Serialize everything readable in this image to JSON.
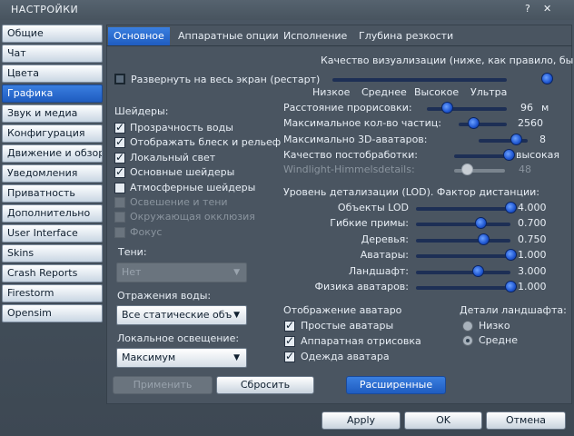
{
  "window": {
    "title": "НАСТРОЙКИ",
    "help": "?",
    "close": "✕"
  },
  "sidebar": [
    "Общие",
    "Чат",
    "Цвета",
    "Графика",
    "Звук и медиа",
    "Конфигурация",
    "Движение и обзор",
    "Уведомления",
    "Приватность",
    "Дополнительно",
    "User Interface",
    "Skins",
    "Crash Reports",
    "Firestorm",
    "Opensim"
  ],
  "sidebar_active": "Графика",
  "tabs": [
    "Основное",
    "Аппаратные опции",
    "Исполнение",
    "Глубина резкости"
  ],
  "fullscreen_label": "Развернуть на весь экран (рестарт)",
  "quality": {
    "label": "Качество визуализации (ниже, как правило, быстр",
    "ticks": [
      "Низкое",
      "Среднее",
      "Высокое",
      "Ультра"
    ],
    "level": "Высокое"
  },
  "shaders": {
    "label": "Шейдеры:",
    "items": [
      {
        "label": "Прозрачность воды",
        "checked": true,
        "enabled": true
      },
      {
        "label": "Отображать блеск и рельеф",
        "checked": true,
        "enabled": true
      },
      {
        "label": "Локальный свет",
        "checked": true,
        "enabled": true
      },
      {
        "label": "Основные шейдеры",
        "checked": true,
        "enabled": true
      },
      {
        "label": "Атмосферные шейдеры",
        "checked": false,
        "enabled": true
      },
      {
        "label": "Освешение и тени",
        "checked": false,
        "enabled": false
      },
      {
        "label": "Окружающая окклюзия",
        "checked": false,
        "enabled": false
      },
      {
        "label": "Фокус",
        "checked": false,
        "enabled": false
      }
    ]
  },
  "shadows": {
    "label": "Тени:",
    "value": "Нет"
  },
  "water": {
    "label": "Отражения воды:",
    "value": "Все статические объ"
  },
  "local_light": {
    "label": "Локальное освещение:",
    "value": "Максимум"
  },
  "params": {
    "draw_distance": {
      "label": "Расстояние прорисовки:",
      "value": "96",
      "unit": "м",
      "level": 0.25
    },
    "particles": {
      "label": "Максимальное кол-во частиц:",
      "value": "2560",
      "level": 0.3
    },
    "avatars3d": {
      "label": "Максимально 3D-аватаров:",
      "value": "8",
      "level": 0.75
    },
    "postprocess": {
      "label": "Качество постобработки:",
      "value": "высокая",
      "level": 1.0
    },
    "windlight": {
      "label": "Windlight-Himmelsdetails:",
      "value": "48",
      "level": 0.25
    }
  },
  "lod": {
    "label": "Уровень детализации (LOD). Фактор дистанции:",
    "items": [
      {
        "label": "Объекты LOD",
        "value": "4.000",
        "level": 1.0
      },
      {
        "label": "Гибкие примы:",
        "value": "0.700",
        "level": 0.68
      },
      {
        "label": "Деревья:",
        "value": "0.750",
        "level": 0.71
      },
      {
        "label": "Аватары:",
        "value": "1.000",
        "level": 1.0
      },
      {
        "label": "Ландшафт:",
        "value": "3.000",
        "level": 0.65
      },
      {
        "label": "Физика аватаров:",
        "value": "1.000",
        "level": 1.0
      }
    ]
  },
  "avatar_render": {
    "label": "Отображение аватаро",
    "items": [
      {
        "label": "Простые аватары",
        "checked": true
      },
      {
        "label": "Аппаратная отрисовка",
        "checked": true
      },
      {
        "label": "Одежда аватара",
        "checked": true
      }
    ]
  },
  "terrain": {
    "label": "Детали ландшафта:",
    "options": [
      "Низко",
      "Средне"
    ],
    "selected": "Средне"
  },
  "buttons": {
    "apply_inner": "Применить",
    "reset": "Сбросить",
    "advanced": "Расширенные",
    "apply": "Apply",
    "ok": "OK",
    "cancel": "Отмена"
  }
}
